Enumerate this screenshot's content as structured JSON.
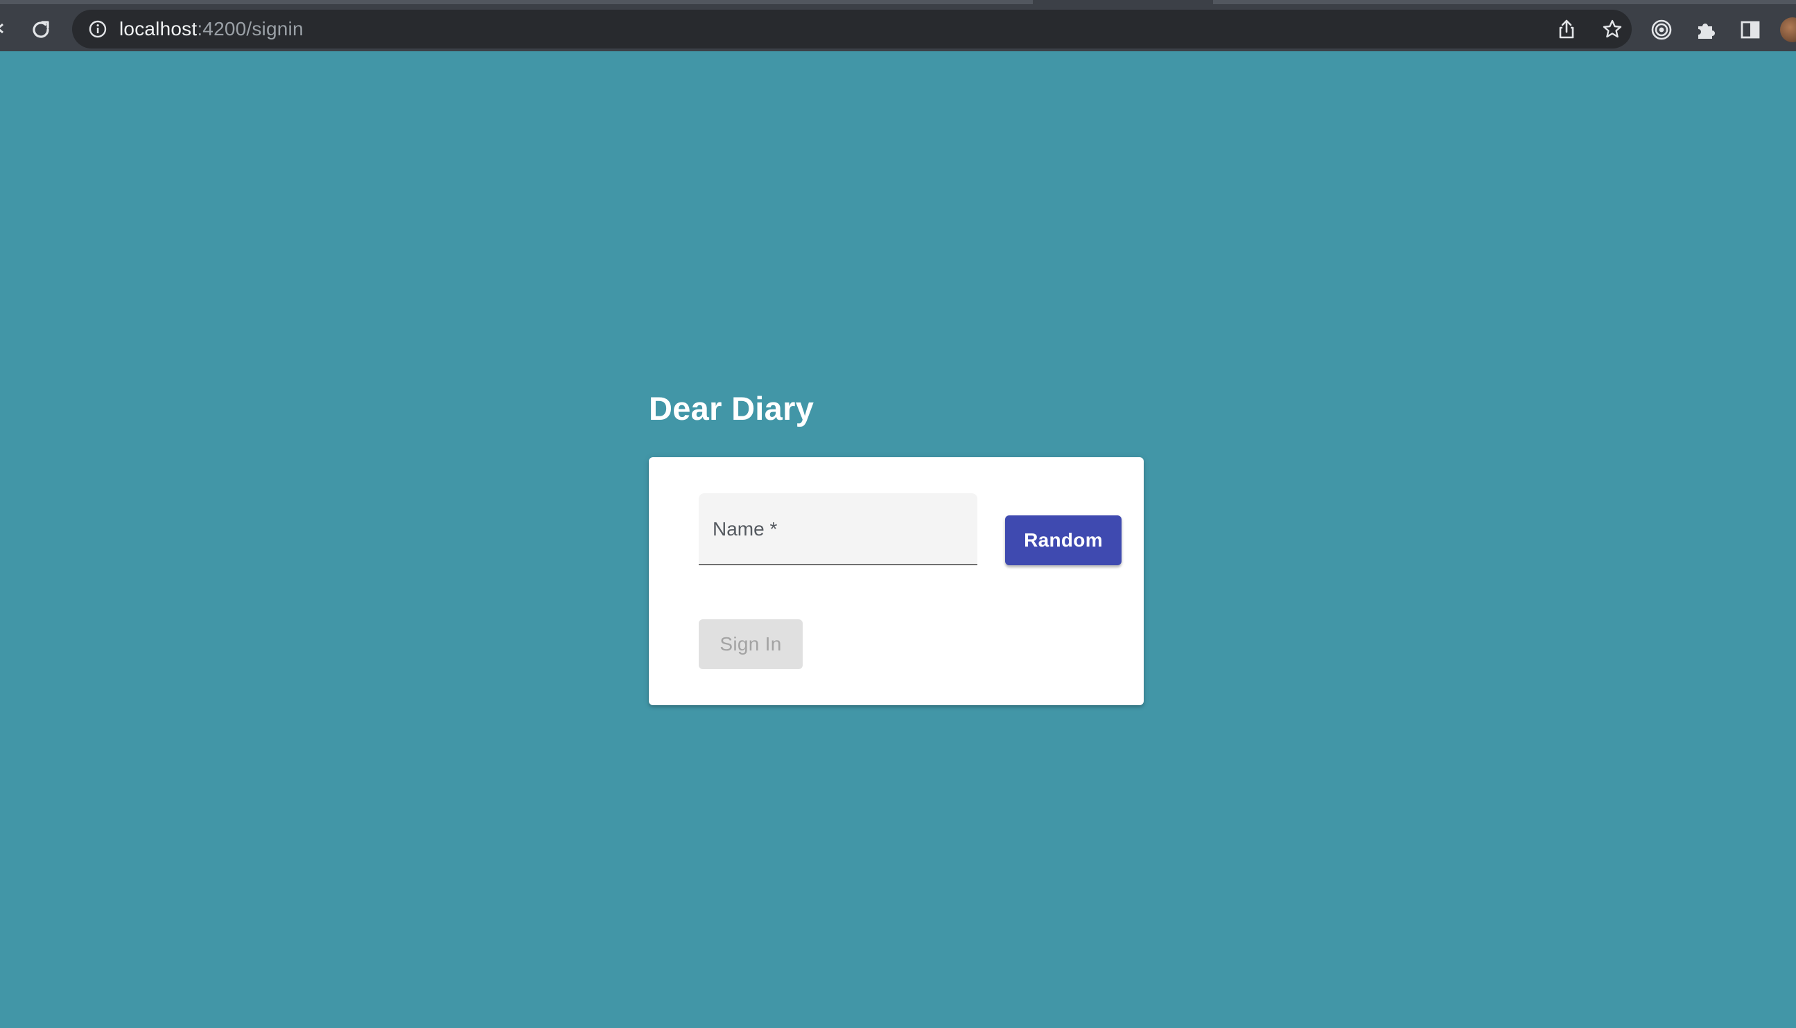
{
  "browser": {
    "url_host": "localhost",
    "url_path": ":4200/signin",
    "icons": {
      "back": "back-arrow-icon",
      "reload": "reload-icon",
      "site_info": "info-icon",
      "share": "share-icon",
      "bookmark": "star-icon",
      "extension_target": "target-icon",
      "extensions": "puzzle-icon",
      "side_panel": "side-panel-icon",
      "profile": "avatar"
    }
  },
  "page": {
    "title": "Dear Diary",
    "form": {
      "name_label": "Name *",
      "name_value": "",
      "random_label": "Random",
      "signin_label": "Sign In",
      "signin_disabled": true
    }
  },
  "colors": {
    "background": "#4296a7",
    "primary_button": "#3f4ab0",
    "disabled_button": "#e0e0e0",
    "card": "#ffffff"
  }
}
